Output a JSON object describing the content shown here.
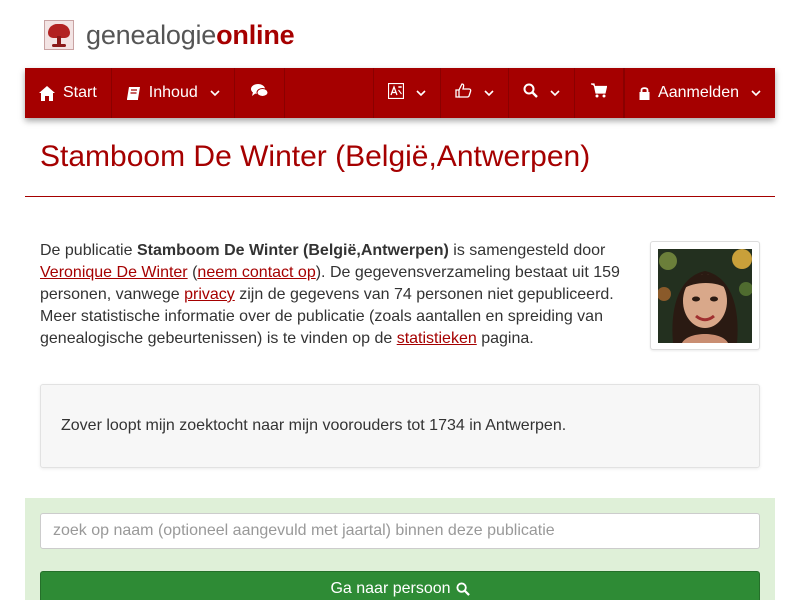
{
  "brand": {
    "text_plain": "genealogie",
    "text_strong": "online"
  },
  "nav": {
    "start": "Start",
    "inhoud": "Inhoud",
    "aanmelden": "Aanmelden"
  },
  "page": {
    "title": "Stamboom De Winter (België,Antwerpen)"
  },
  "description": {
    "p1": "De publicatie ",
    "publication_name": "Stamboom De Winter (België,Antwerpen)",
    "p2": " is samengesteld door ",
    "author_link": "Veronique De Winter",
    "p3": " (",
    "contact_link": "neem contact op",
    "p4": "). De gegevensverzameling bestaat uit 159 personen, vanwege ",
    "privacy_link": "privacy",
    "p5": " zijn de gegevens van 74 personen niet gepubliceerd. Meer statistische informatie over de publicatie (zoals aantallen en spreiding van genealogische gebeurtenissen) is te vinden op de ",
    "stats_link": "statistieken",
    "p6": " pagina."
  },
  "quote": "Zover loopt mijn zoektocht naar mijn voorouders tot 1734 in Antwerpen.",
  "search": {
    "placeholder": "zoek op naam (optioneel aangevuld met jaartal) binnen deze publicatie",
    "button_label": "Ga naar persoon"
  },
  "colors": {
    "brand_red": "#a50000",
    "search_bg": "#dff0d8",
    "button_green": "#2e8b35"
  }
}
